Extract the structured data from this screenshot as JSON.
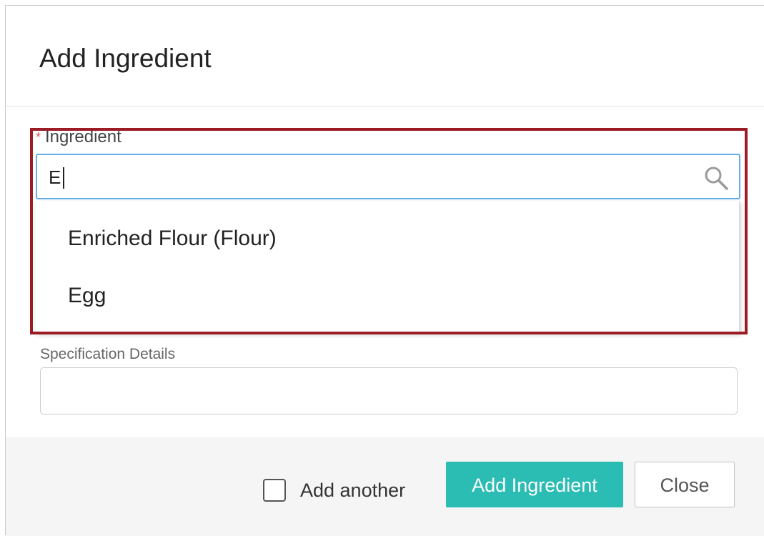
{
  "modal": {
    "title": "Add Ingredient"
  },
  "ingredient_field": {
    "required_marker": "*",
    "label": "Ingredient",
    "value": "E",
    "icon": "search-icon"
  },
  "dropdown": {
    "options": [
      {
        "label": "Enriched Flour (Flour)"
      },
      {
        "label": "Egg"
      }
    ]
  },
  "specification_field": {
    "label": "Specification Details",
    "value": ""
  },
  "footer": {
    "add_another_label": "Add another",
    "add_another_checked": false,
    "submit_label": "Add Ingredient",
    "close_label": "Close"
  },
  "colors": {
    "accent": "#2bbcb4",
    "focus_border": "#66afe9",
    "highlight": "#9b1c24",
    "required": "#d9534f"
  }
}
